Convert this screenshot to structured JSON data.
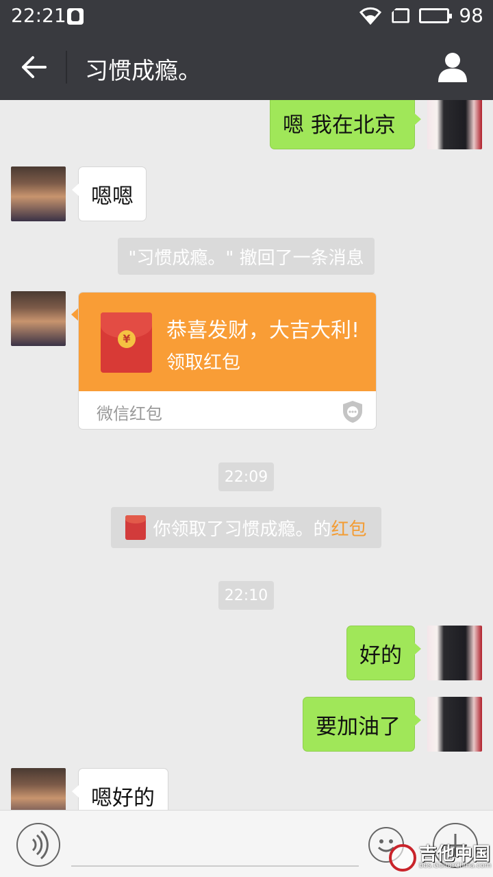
{
  "status_bar": {
    "time": "22:21",
    "battery": "98"
  },
  "header": {
    "title": "习惯成瘾。"
  },
  "messages": {
    "m1": "嗯  我在北京",
    "m2": "嗯嗯",
    "recall_notice": "\"习惯成瘾。\" 撤回了一条消息",
    "red_packet": {
      "greeting": "恭喜发财，大吉大利!",
      "action": "领取红包",
      "footer": "微信红包"
    },
    "time1": "22:09",
    "receipt_prefix": "你领取了习惯成瘾。的",
    "receipt_link": "红包",
    "time2": "22:10",
    "m3": "好的",
    "m4": "要加油了",
    "m5": "嗯好的"
  },
  "watermark": {
    "title": "吉他中国",
    "sub": "bbs.GuitarChina.com"
  },
  "colors": {
    "bar": "#393a3f",
    "green_bubble": "#a0e759",
    "red_packet": "#f99d36",
    "link": "#f39c33"
  }
}
